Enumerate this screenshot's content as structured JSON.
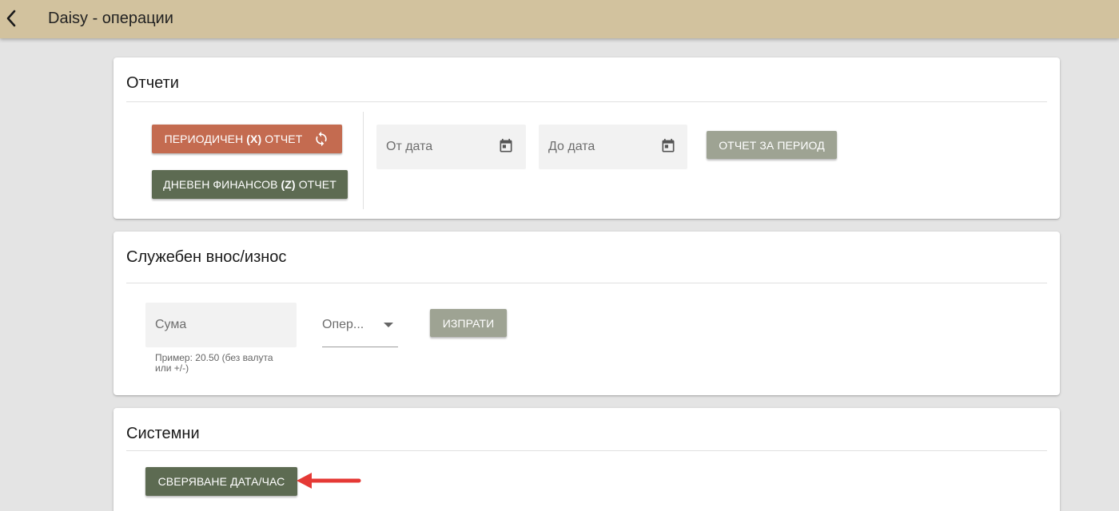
{
  "header": {
    "title": "Daisy - операции"
  },
  "reports": {
    "title": "Отчети",
    "periodic_x": {
      "prefix": "ПЕРИОДИЧЕН ",
      "bold": "(X)",
      "suffix": " ОТЧЕТ"
    },
    "daily_z": {
      "prefix": "ДНЕВЕН ФИНАНСОВ ",
      "bold": "(Z)",
      "suffix": " ОТЧЕТ"
    },
    "from_date_placeholder": "От дата",
    "to_date_placeholder": "До дата",
    "period_report_label": "ОТЧЕТ ЗА ПЕРИОД"
  },
  "cash": {
    "title": "Служебен внос/износ",
    "amount_placeholder": "Сума",
    "amount_hint": "Пример: 20.50 (без валута или +/-)",
    "operation_placeholder": "Опер...",
    "send_label": "ИЗПРАТИ"
  },
  "system": {
    "title": "Системни",
    "sync_label": "СВЕРЯВАНЕ ДАТА/ЧАС"
  },
  "colors": {
    "topbar": "#d2c29e",
    "orange_button": "#c46b50",
    "green_button": "#5d6b52",
    "gray_button": "#9ea393",
    "annotation_arrow": "#e53935"
  },
  "icons": [
    "back-arrow-icon",
    "refresh-icon",
    "calendar-icon",
    "dropdown-arrow-icon"
  ]
}
